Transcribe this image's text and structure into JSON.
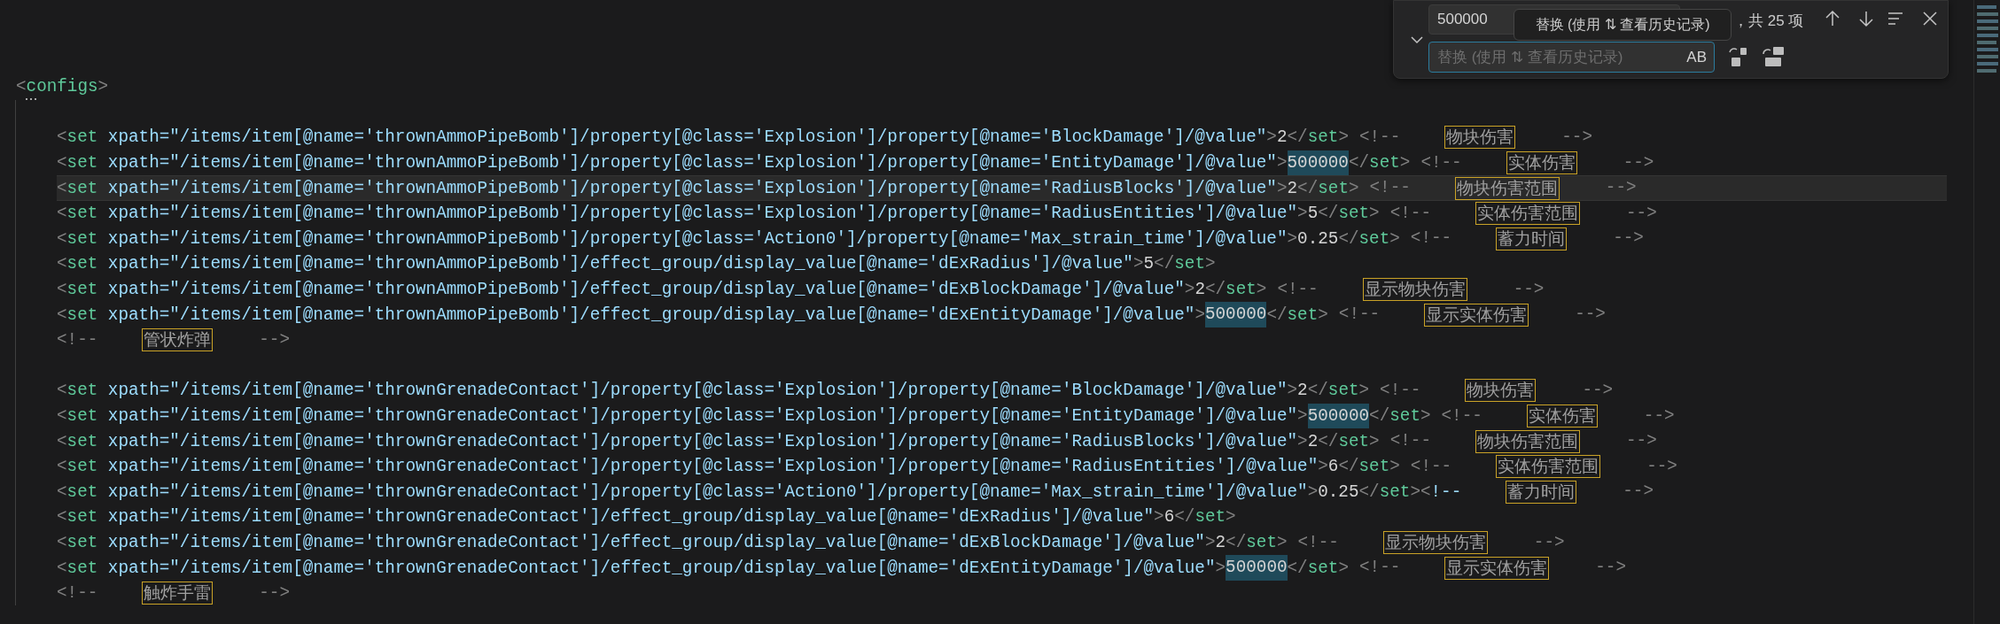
{
  "find_widget": {
    "expanded": true,
    "find": {
      "value": "500000"
    },
    "tooltip": "替换 (使用 ⇅ 查看历史记录)",
    "result": "，共 25 项",
    "replace": {
      "placeholder": "替换 (使用 ⇅ 查看历史记录)",
      "focused": true,
      "preserve_case": "AB"
    }
  },
  "editor": {
    "lines": [
      {
        "kind": "code",
        "current": false,
        "segments": [
          {
            "kind": "code",
            "text": "<configs>"
          }
        ],
        "children": [
          {
            "kind": "blank",
            "current": false
          },
          {
            "kind": "code",
            "current": false,
            "segments": [
              {
                "kind": "code",
                "text": "<set xpath=\"/items/item[@name='thrownAmmoPipeBomb']/property[@class='Explosion']/property[@name='BlockDamage']/@value\">2</set>"
              },
              {
                "kind": "comment",
                "text": "<!--"
              },
              {
                "kind": "note",
                "text": "物块伤害"
              },
              {
                "kind": "comment",
                "text": "-->"
              }
            ]
          },
          {
            "kind": "code",
            "current": false,
            "segments": [
              {
                "kind": "code",
                "text": "<set xpath=\"/items/item[@name='thrownAmmoPipeBomb']/property[@class='Explosion']/property[@name='EntityDamage']/@value\">"
              },
              {
                "kind": "match",
                "text": "500000"
              },
              {
                "kind": "code",
                "text": "</set>"
              },
              {
                "kind": "comment",
                "text": "<!--"
              },
              {
                "kind": "note",
                "text": "实体伤害"
              },
              {
                "kind": "comment",
                "text": "-->"
              }
            ]
          },
          {
            "kind": "code",
            "current": true,
            "segments": [
              {
                "kind": "code",
                "text": "<set xpath=\"/items/item[@name='thrownAmmoPipeBomb']/property[@class='Explosion']/property[@name='RadiusBlocks']/@value\">2</set>"
              },
              {
                "kind": "comment",
                "text": "<!--"
              },
              {
                "kind": "note",
                "text": "物块伤害范围"
              },
              {
                "kind": "comment",
                "text": "-->"
              }
            ]
          },
          {
            "kind": "code",
            "current": false,
            "segments": [
              {
                "kind": "code",
                "text": "<set xpath=\"/items/item[@name='thrownAmmoPipeBomb']/property[@class='Explosion']/property[@name='RadiusEntities']/@value\">5</set>"
              },
              {
                "kind": "comment",
                "text": "<!--"
              },
              {
                "kind": "note",
                "text": "实体伤害范围"
              },
              {
                "kind": "comment",
                "text": "-->"
              }
            ]
          },
          {
            "kind": "code",
            "current": false,
            "segments": [
              {
                "kind": "code",
                "text": "<set xpath=\"/items/item[@name='thrownAmmoPipeBomb']/property[@class='Action0']/property[@name='Max_strain_time']/@value\">0.25</set>"
              },
              {
                "kind": "comment",
                "text": "<!--"
              },
              {
                "kind": "note",
                "text": "蓄力时间"
              },
              {
                "kind": "comment",
                "text": "-->"
              }
            ]
          },
          {
            "kind": "code",
            "current": false,
            "segments": [
              {
                "kind": "code",
                "text": "<set xpath=\"/items/item[@name='thrownAmmoPipeBomb']/effect_group/display_value[@name='dExRadius']/@value\">5</set>"
              }
            ]
          },
          {
            "kind": "code",
            "current": false,
            "segments": [
              {
                "kind": "code",
                "text": "<set xpath=\"/items/item[@name='thrownAmmoPipeBomb']/effect_group/display_value[@name='dExBlockDamage']/@value\">2</set>"
              },
              {
                "kind": "comment",
                "text": "<!--"
              },
              {
                "kind": "note",
                "text": "显示物块伤害"
              },
              {
                "kind": "comment",
                "text": "-->"
              }
            ]
          },
          {
            "kind": "code",
            "current": false,
            "segments": [
              {
                "kind": "code",
                "text": "<set xpath=\"/items/item[@name='thrownAmmoPipeBomb']/effect_group/display_value[@name='dExEntityDamage']/@value\">"
              },
              {
                "kind": "match",
                "text": "500000"
              },
              {
                "kind": "code",
                "text": "</set>"
              },
              {
                "kind": "comment",
                "text": "<!--"
              },
              {
                "kind": "note",
                "text": "显示实体伤害"
              },
              {
                "kind": "comment",
                "text": "-->"
              }
            ]
          },
          {
            "kind": "code",
            "current": false,
            "segments": [
              {
                "kind": "comment",
                "text": "<!--"
              },
              {
                "kind": "note",
                "text": "管状炸弹"
              },
              {
                "kind": "comment",
                "text": "-->"
              }
            ]
          },
          {
            "kind": "blank",
            "current": false
          },
          {
            "kind": "code",
            "current": false,
            "segments": [
              {
                "kind": "code",
                "text": "<set xpath=\"/items/item[@name='thrownGrenadeContact']/property[@class='Explosion']/property[@name='BlockDamage']/@value\">2</set>"
              },
              {
                "kind": "comment",
                "text": "<!--"
              },
              {
                "kind": "note",
                "text": "物块伤害"
              },
              {
                "kind": "comment",
                "text": "-->"
              }
            ]
          },
          {
            "kind": "code",
            "current": false,
            "segments": [
              {
                "kind": "code",
                "text": "<set xpath=\"/items/item[@name='thrownGrenadeContact']/property[@class='Explosion']/property[@name='EntityDamage']/@value\">"
              },
              {
                "kind": "match",
                "text": "500000"
              },
              {
                "kind": "code",
                "text": "</set>"
              },
              {
                "kind": "comment",
                "text": "<!--"
              },
              {
                "kind": "note",
                "text": "实体伤害"
              },
              {
                "kind": "comment",
                "text": "-->"
              }
            ]
          },
          {
            "kind": "code",
            "current": false,
            "segments": [
              {
                "kind": "code",
                "text": "<set xpath=\"/items/item[@name='thrownGrenadeContact']/property[@class='Explosion']/property[@name='RadiusBlocks']/@value\">2</set>"
              },
              {
                "kind": "comment",
                "text": "<!--"
              },
              {
                "kind": "note",
                "text": "物块伤害范围"
              },
              {
                "kind": "comment",
                "text": "-->"
              }
            ]
          },
          {
            "kind": "code",
            "current": false,
            "segments": [
              {
                "kind": "code",
                "text": "<set xpath=\"/items/item[@name='thrownGrenadeContact']/property[@class='Explosion']/property[@name='RadiusEntities']/@value\">6</set>"
              },
              {
                "kind": "comment",
                "text": "<!--"
              },
              {
                "kind": "note",
                "text": "实体伤害范围"
              },
              {
                "kind": "comment",
                "text": "-->"
              }
            ]
          },
          {
            "kind": "code",
            "current": false,
            "segments": [
              {
                "kind": "code",
                "text": "<set xpath=\"/items/item[@name='thrownGrenadeContact']/property[@class='Action0']/property[@name='Max_strain_time']/@value\">0.25</set><!--"
              },
              {
                "kind": "note",
                "text": "蓄力时间"
              },
              {
                "kind": "comment",
                "text": "-->"
              }
            ]
          },
          {
            "kind": "code",
            "current": false,
            "segments": [
              {
                "kind": "code",
                "text": "<set xpath=\"/items/item[@name='thrownGrenadeContact']/effect_group/display_value[@name='dExRadius']/@value\">6</set>"
              }
            ]
          },
          {
            "kind": "code",
            "current": false,
            "segments": [
              {
                "kind": "code",
                "text": "<set xpath=\"/items/item[@name='thrownGrenadeContact']/effect_group/display_value[@name='dExBlockDamage']/@value\">2</set>"
              },
              {
                "kind": "comment",
                "text": "<!--"
              },
              {
                "kind": "note",
                "text": "显示物块伤害"
              },
              {
                "kind": "comment",
                "text": "-->"
              }
            ]
          },
          {
            "kind": "code",
            "current": false,
            "segments": [
              {
                "kind": "code",
                "text": "<set xpath=\"/items/item[@name='thrownGrenadeContact']/effect_group/display_value[@name='dExEntityDamage']/@value\">"
              },
              {
                "kind": "match",
                "text": "500000"
              },
              {
                "kind": "code",
                "text": "</set>"
              },
              {
                "kind": "comment",
                "text": "<!--"
              },
              {
                "kind": "note",
                "text": "显示实体伤害"
              },
              {
                "kind": "comment",
                "text": "-->"
              }
            ]
          },
          {
            "kind": "code",
            "current": false,
            "segments": [
              {
                "kind": "comment",
                "text": "<!--"
              },
              {
                "kind": "note",
                "text": "触炸手雷"
              },
              {
                "kind": "comment",
                "text": "-->"
              }
            ]
          }
        ]
      }
    ]
  }
}
